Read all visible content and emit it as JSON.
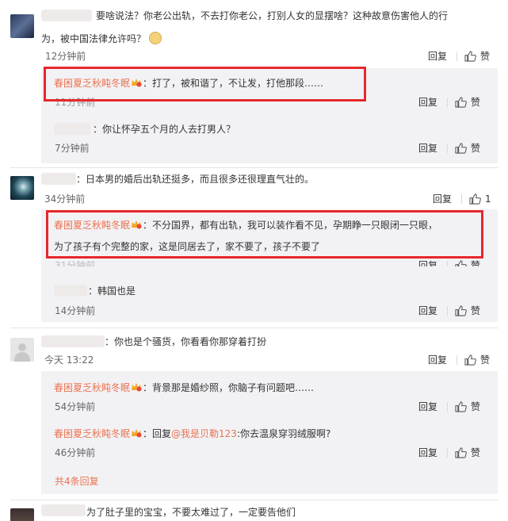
{
  "comments": [
    {
      "text_line1": "要啥说法？你老公出轨，不去打你老公，打别人女的显摆啥？这种故意伤害他人的行",
      "text_line2": "为，被中国法律允许吗？",
      "time": "12分钟前",
      "reply_label": "回复",
      "like_label": "赞",
      "replies": [
        {
          "user": "春困夏乏秋盹冬眠",
          "text": "：打了，被和谐了，不让发，打他那段……",
          "time": "11分钟前",
          "reply_label": "回复",
          "like_label": "赞"
        },
        {
          "text": "：你让怀孕五个月的人去打男人？",
          "time": "7分钟前",
          "reply_label": "回复",
          "like_label": "赞"
        }
      ]
    },
    {
      "text": "：日本男的婚后出轨还挺多，而且很多还很理直气壮的。",
      "time": "34分钟前",
      "reply_label": "回复",
      "like_count": "1",
      "replies": [
        {
          "user": "春困夏乏秋盹冬眠",
          "text_line1": "：不分国界，都有出轨，我可以装作看不见，孕期睁一只眼闭一只眼，",
          "text_line2": "为了孩子有个完整的家，这是同居去了，家不要了，孩子不要了",
          "time": "31分钟前",
          "reply_label": "回复",
          "like_label": "赞"
        },
        {
          "text": "：韩国也是",
          "time": "14分钟前",
          "reply_label": "回复",
          "like_label": "赞"
        }
      ]
    },
    {
      "text": "：你也是个骚货，你看看你那穿着打扮",
      "time": "今天 13:22",
      "reply_label": "回复",
      "like_label": "赞",
      "replies": [
        {
          "user": "春困夏乏秋盹冬眠",
          "text": "：背景那是婚纱照，你脑子有问题吧……",
          "time": "54分钟前",
          "reply_label": "回复",
          "like_label": "赞"
        },
        {
          "user": "春困夏乏秋盹冬眠",
          "prefix": "：回复",
          "mention": "@我是贝勒123",
          "text": ":你去温泉穿羽绒服啊?",
          "time": "46分钟前",
          "reply_label": "回复",
          "like_label": "赞"
        }
      ],
      "total_replies": "共4条回复"
    },
    {
      "text": "为了肚子里的宝宝，不要太难过了，一定要告他们"
    }
  ],
  "colors": {
    "username": "#eb7350",
    "highlight_box": "#e6282b",
    "reply_bg": "#f2f2f5"
  },
  "icons": [
    "thumbs-up-icon",
    "crown-badge-icon",
    "doge-emoji-icon",
    "default-avatar-icon"
  ]
}
